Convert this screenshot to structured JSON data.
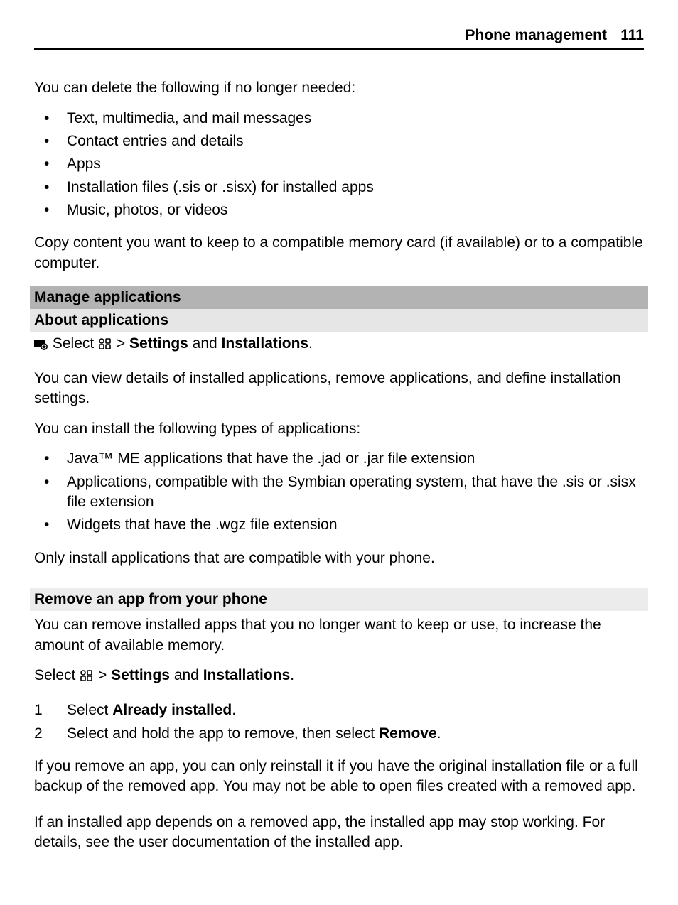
{
  "header": {
    "section": "Phone management",
    "page": "111"
  },
  "intro": {
    "lead": "You can delete the following if no longer needed:",
    "items": [
      "Text, multimedia, and mail messages",
      "Contact entries and details",
      "Apps",
      "Installation files (.sis or .sisx) for installed apps",
      "Music, photos, or videos"
    ],
    "followup": "Copy content you want to keep to a compatible memory card (if available) or to a compatible computer."
  },
  "manage": {
    "heading_primary": "Manage applications",
    "heading_secondary": "About applications",
    "select_prefix": "Select ",
    "select_sep": " > ",
    "select_bold1": "Settings",
    "select_mid": " and ",
    "select_bold2": "Installations",
    "select_suffix": ".",
    "para1": "You can view details of installed applications, remove applications, and define installation settings.",
    "para2": "You can install the following types of applications:",
    "types": [
      "Java™ ME applications that have the .jad or .jar file extension",
      "Applications, compatible with the Symbian operating system, that have the .sis or .sisx file extension",
      "Widgets that have the .wgz file extension"
    ],
    "para3": "Only install applications that are compatible with your phone."
  },
  "remove": {
    "heading": "Remove an app from your phone",
    "para1": "You can remove installed apps that you no longer want to keep or use, to increase the amount of available memory.",
    "select_prefix": "Select ",
    "select_sep": " > ",
    "select_bold1": "Settings",
    "select_mid": " and ",
    "select_bold2": "Installations",
    "select_suffix": ".",
    "step1_a": "Select ",
    "step1_b": "Already installed",
    "step1_c": ".",
    "step2_a": "Select and hold the app to remove, then select ",
    "step2_b": "Remove",
    "step2_c": ".",
    "para2": "If you remove an app, you can only reinstall it if you have the original installation file or a full backup of the removed app. You may not be able to open files created with a removed app.",
    "para3": "If an installed app depends on a removed app, the installed app may stop working. For details, see the user documentation of the installed app."
  }
}
